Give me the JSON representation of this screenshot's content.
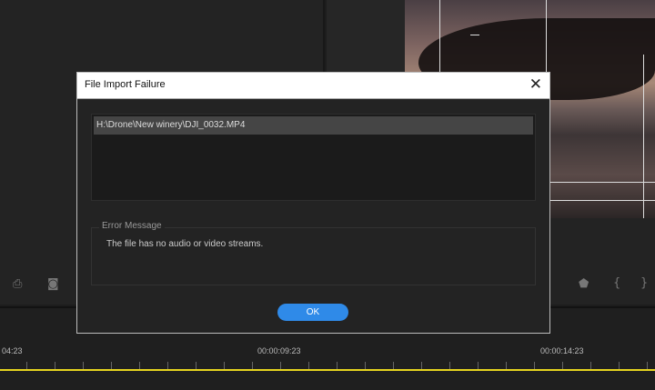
{
  "dialog": {
    "title": "File Import Failure",
    "close_icon": "close-icon",
    "files": [
      "H:\\Drone\\New winery\\DJI_0032.MP4"
    ],
    "error_group_label": "Error Message",
    "error_text": "The file has no audio or video streams.",
    "ok_label": "OK"
  },
  "timeline": {
    "timecodes": [
      "04:23",
      "00:00:09:23",
      "00:00:14:23"
    ],
    "playhead_color": "#e6d41f"
  },
  "toolbar_icons": [
    "export-frame-icon",
    "camera-icon",
    "marker-icon",
    "mark-in-icon",
    "mark-out-icon"
  ],
  "colors": {
    "accent": "#2f8ae8"
  }
}
